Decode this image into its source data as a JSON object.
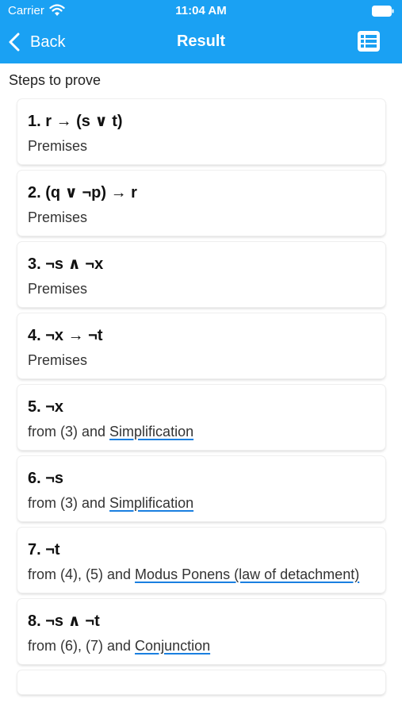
{
  "status_bar": {
    "carrier": "Carrier",
    "time": "11:04 AM"
  },
  "nav": {
    "back_label": "Back",
    "title": "Result",
    "right_icon": "list-icon"
  },
  "section_title": "Steps to prove",
  "colors": {
    "header_bg": "#1aa1f3",
    "link_underline": "#1a7fe0"
  },
  "steps": [
    {
      "formula": "1. r → (s ∨ t)",
      "reason": "Premises",
      "rule": ""
    },
    {
      "formula": "2. (q ∨ ¬p) → r",
      "reason": "Premises",
      "rule": ""
    },
    {
      "formula": "3. ¬s ∧ ¬x",
      "reason": "Premises",
      "rule": ""
    },
    {
      "formula": "4. ¬x → ¬t",
      "reason": "Premises",
      "rule": ""
    },
    {
      "formula": "5. ¬x",
      "reason": "from (3) and ",
      "rule": "Simplification"
    },
    {
      "formula": "6. ¬s",
      "reason": "from (3) and ",
      "rule": "Simplification"
    },
    {
      "formula": "7. ¬t",
      "reason": "from (4), (5) and ",
      "rule": "Modus Ponens (law of detachment)"
    },
    {
      "formula": "8. ¬s ∧ ¬t",
      "reason": "from (6), (7) and ",
      "rule": "Conjunction"
    },
    {
      "formula": "",
      "reason": "",
      "rule": ""
    }
  ]
}
